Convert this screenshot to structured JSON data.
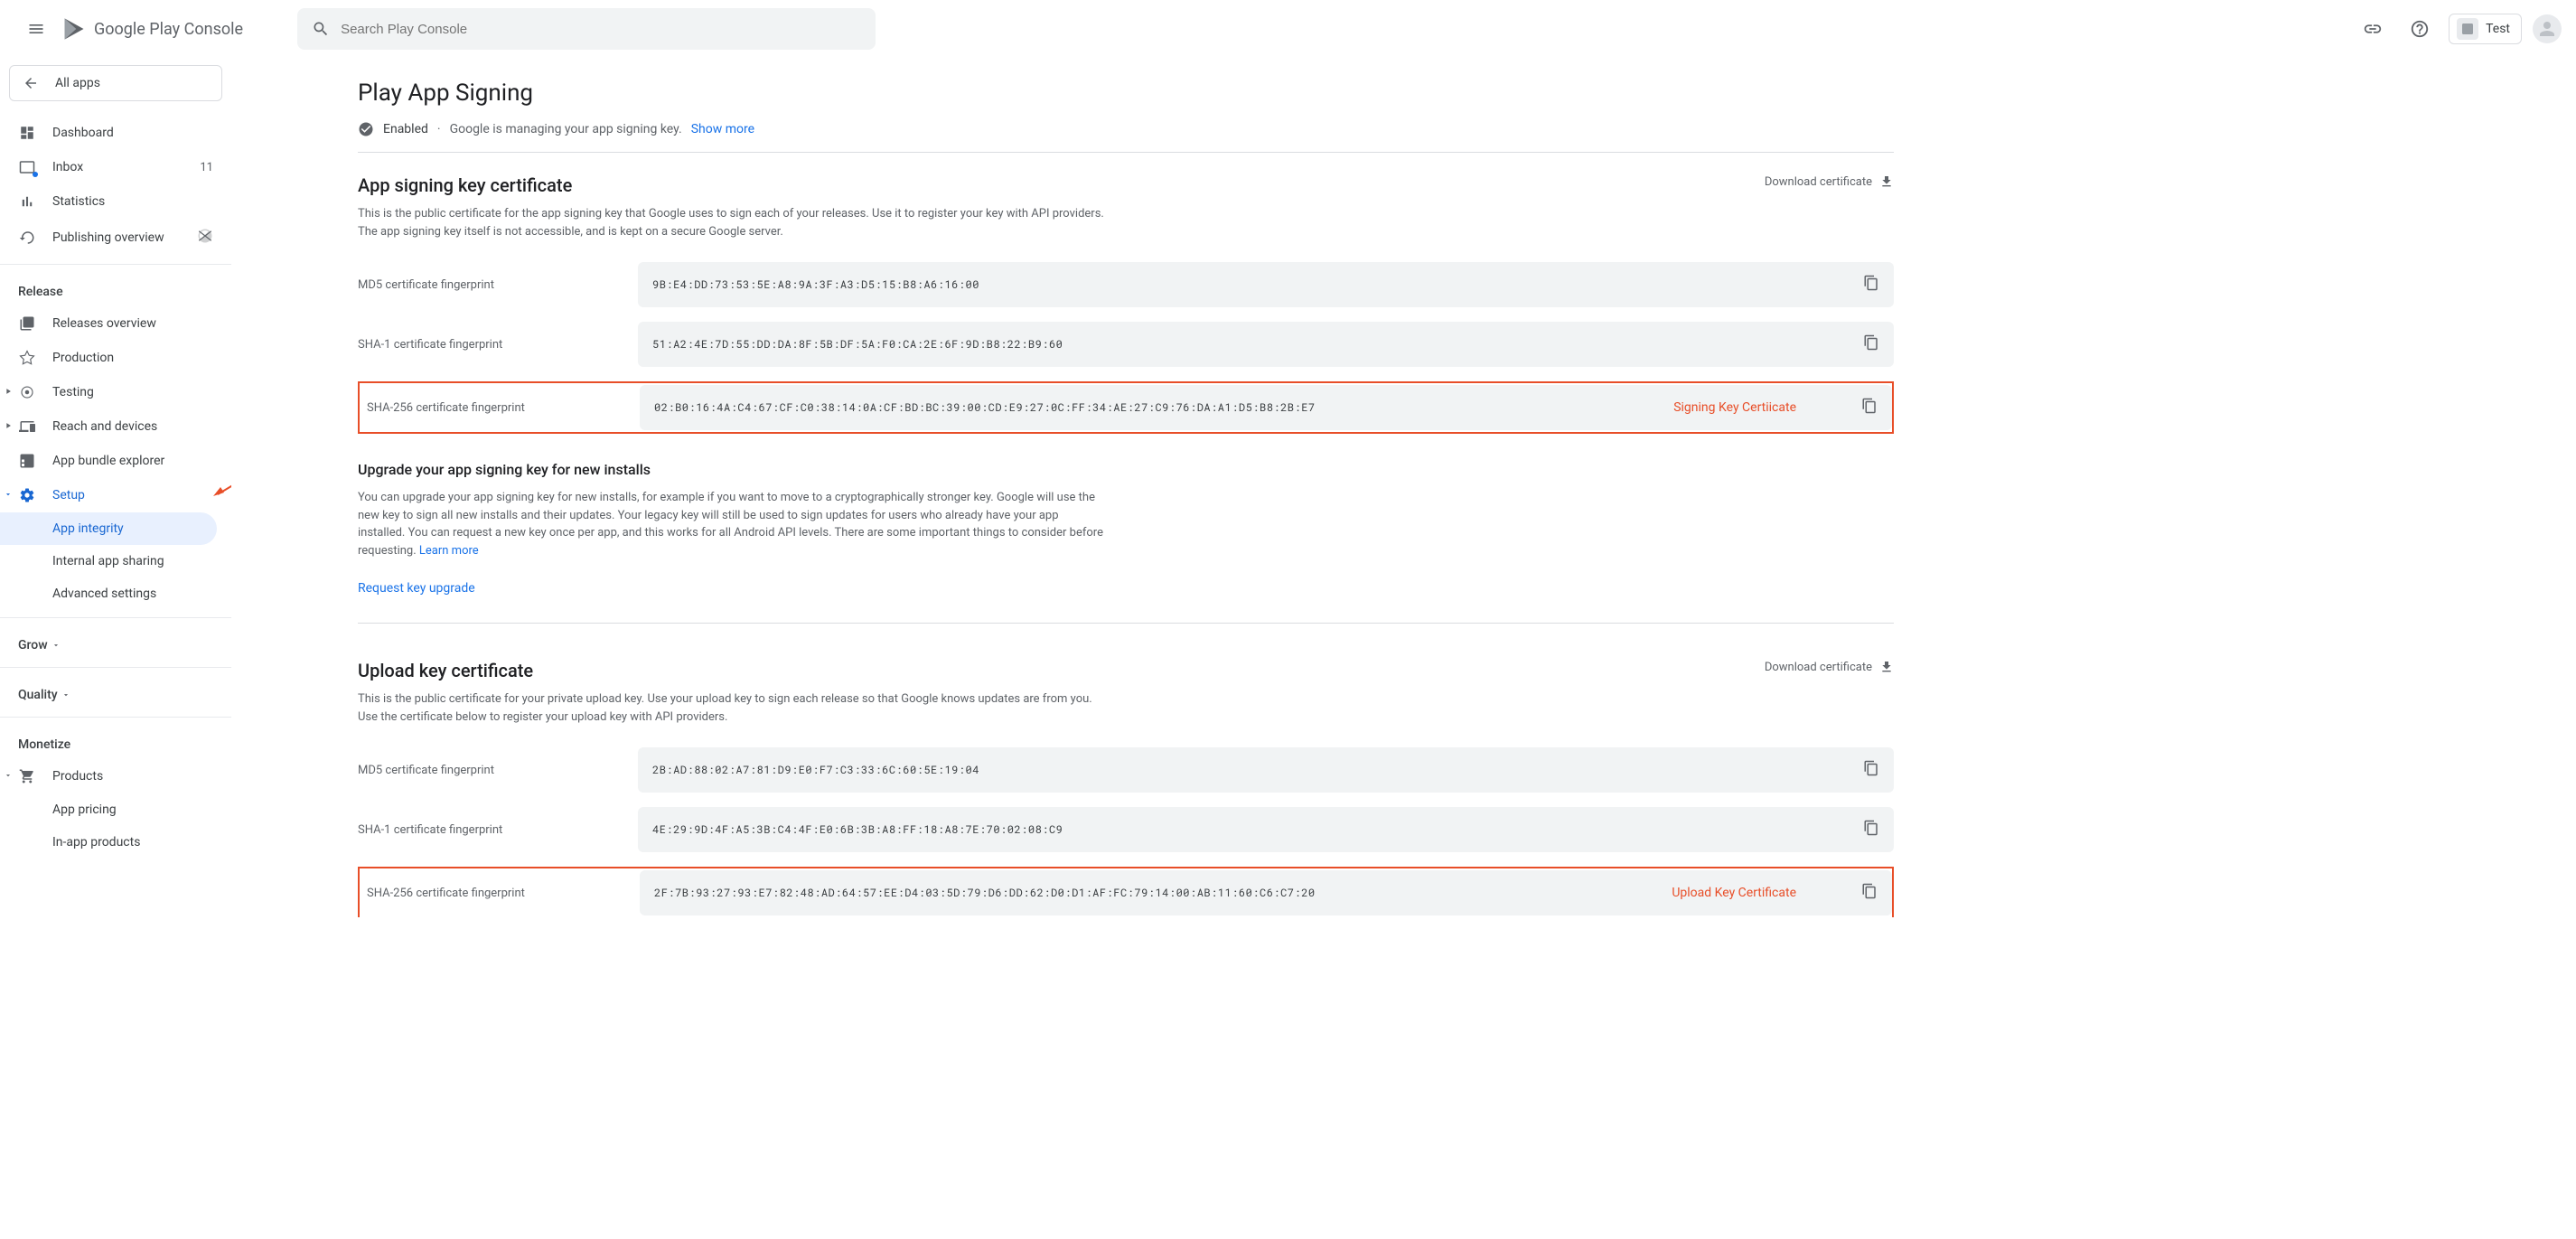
{
  "header": {
    "logo": "Google Play Console",
    "search_placeholder": "Search Play Console",
    "app_name": "Test"
  },
  "sidebar": {
    "all_apps": "All apps",
    "items": {
      "dashboard": "Dashboard",
      "inbox": "Inbox",
      "inbox_count": "11",
      "statistics": "Statistics",
      "publishing": "Publishing overview"
    },
    "release_header": "Release",
    "release": {
      "overview": "Releases overview",
      "production": "Production",
      "testing": "Testing",
      "reach": "Reach and devices",
      "bundle": "App bundle explorer",
      "setup": "Setup",
      "integrity": "App integrity",
      "internal_sharing": "Internal app sharing",
      "advanced": "Advanced settings"
    },
    "grow_header": "Grow",
    "quality_header": "Quality",
    "monetize_header": "Monetize",
    "monetize": {
      "products": "Products",
      "pricing": "App pricing",
      "inapp": "In-app products"
    }
  },
  "page": {
    "title": "Play App Signing",
    "status_enabled": "Enabled",
    "status_text": "Google is managing your app signing key.",
    "show_more": "Show more"
  },
  "signing": {
    "title": "App signing key certificate",
    "desc": "This is the public certificate for the app signing key that Google uses to sign each of your releases. Use it to register your key with API providers. The app signing key itself is not accessible, and is kept on a secure Google server.",
    "download": "Download certificate",
    "rows": [
      {
        "label": "MD5 certificate fingerprint",
        "value": "9B:E4:DD:73:53:5E:A8:9A:3F:A3:D5:15:B8:A6:16:00"
      },
      {
        "label": "SHA-1 certificate fingerprint",
        "value": "51:A2:4E:7D:55:DD:DA:8F:5B:DF:5A:F0:CA:2E:6F:9D:B8:22:B9:60"
      },
      {
        "label": "SHA-256 certificate fingerprint",
        "value": "02:B0:16:4A:C4:67:CF:C0:38:14:0A:CF:BD:BC:39:00:CD:E9:27:0C:FF:34:AE:27:C9:76:DA:A1:D5:B8:2B:E7"
      }
    ],
    "annotation": "Signing Key Certiicate"
  },
  "upgrade": {
    "title": "Upgrade your app signing key for new installs",
    "desc": "You can upgrade your app signing key for new installs, for example if you want to move to a cryptographically stronger key. Google will use the new key to sign all new installs and their updates. Your legacy key will still be used to sign updates for users who already have your app installed. You can request a new key once per app, and this works for all Android API levels. There are some important things to consider before requesting.",
    "learn_more": "Learn more",
    "request": "Request key upgrade"
  },
  "upload": {
    "title": "Upload key certificate",
    "desc": "This is the public certificate for your private upload key. Use your upload key to sign each release so that Google knows updates are from you. Use the certificate below to register your upload key with API providers.",
    "download": "Download certificate",
    "rows": [
      {
        "label": "MD5 certificate fingerprint",
        "value": "2B:AD:88:02:A7:81:D9:E0:F7:C3:33:6C:60:5E:19:04"
      },
      {
        "label": "SHA-1 certificate fingerprint",
        "value": "4E:29:9D:4F:A5:3B:C4:4F:E0:6B:3B:A8:FF:18:A8:7E:70:02:08:C9"
      },
      {
        "label": "SHA-256 certificate fingerprint",
        "value": "2F:7B:93:27:93:E7:82:48:AD:64:57:EE:D4:03:5D:79:D6:DD:62:D0:D1:AF:FC:79:14:00:AB:11:60:C6:C7:20"
      }
    ],
    "annotation": "Upload Key Certificate"
  }
}
